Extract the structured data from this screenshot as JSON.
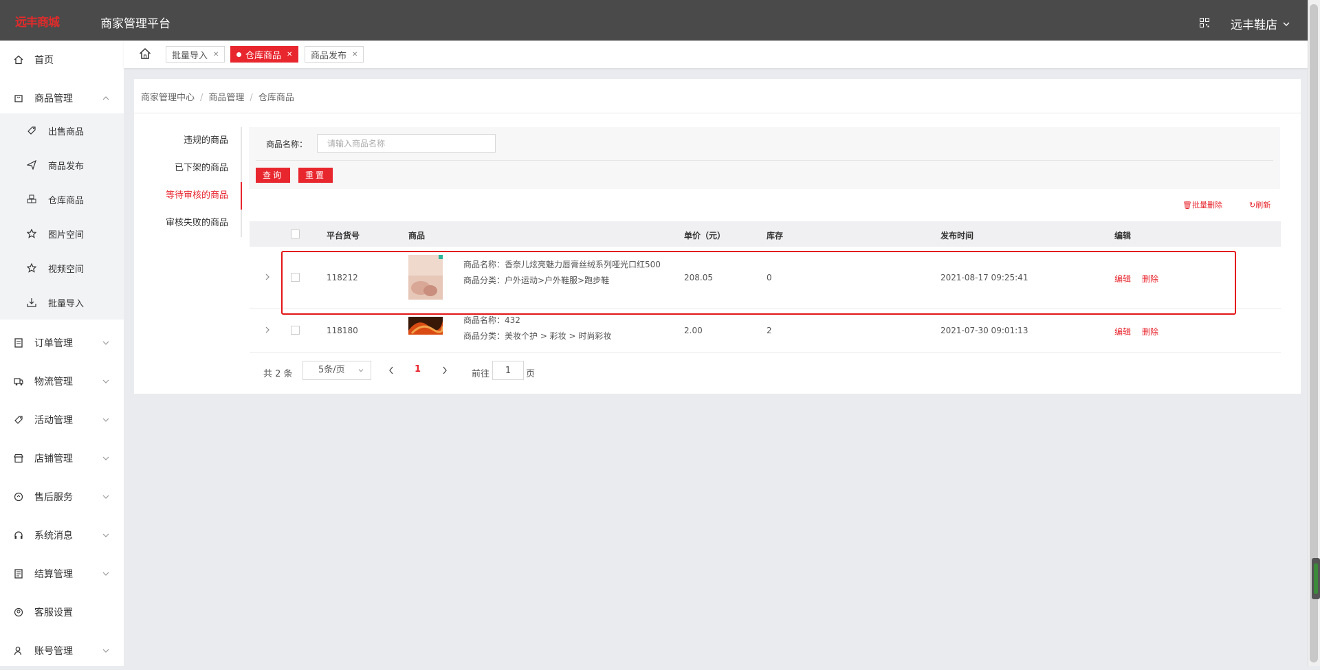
{
  "header": {
    "logo_text": "远丰商城",
    "platform_title": "商家管理平台",
    "shop_name": "远丰鞋店"
  },
  "sidebar": {
    "home": "首页",
    "product_mgmt": "商品管理",
    "sub": [
      "出售商品",
      "商品发布",
      "仓库商品",
      "图片空间",
      "视频空间",
      "批量导入"
    ],
    "order_mgmt": "订单管理",
    "logistics_mgmt": "物流管理",
    "activity_mgmt": "活动管理",
    "store_mgmt": "店铺管理",
    "after_sales": "售后服务",
    "sys_msg": "系统消息",
    "settlement_mgmt": "结算管理",
    "cs_settings": "客服设置",
    "account_mgmt": "账号管理"
  },
  "tabs": [
    {
      "label": "批量导入",
      "active": false
    },
    {
      "label": "仓库商品",
      "active": true
    },
    {
      "label": "商品发布",
      "active": false
    }
  ],
  "breadcrumb": [
    "商家管理中心",
    "商品管理",
    "仓库商品"
  ],
  "status_nav": [
    "违规的商品",
    "已下架的商品",
    "等待审核的商品",
    "审核失败的商品"
  ],
  "filter": {
    "label": "商品名称：",
    "placeholder": "请输入商品名称",
    "query": "查询",
    "reset": "重置"
  },
  "tools": {
    "batch_delete": "批量删除",
    "refresh": "刷新"
  },
  "table": {
    "headers": [
      "平台货号",
      "商品",
      "单价（元）",
      "库存",
      "发布时间",
      "编辑"
    ],
    "rows": [
      {
        "sku": "118212",
        "name": "商品名称：香奈儿炫亮魅力唇膏丝绒系列哑光口红500",
        "category": "商品分类：户外运动>户外鞋服>跑步鞋",
        "price": "208.05",
        "stock": "0",
        "time": "2021-08-17 09:25:41",
        "edit": "编辑",
        "delete": "删除"
      },
      {
        "sku": "118180",
        "name": "商品名称：432",
        "category": "商品分类：美妆个护 > 彩妆 > 时尚彩妆",
        "price": "2.00",
        "stock": "2",
        "time": "2021-07-30 09:01:13",
        "edit": "编辑",
        "delete": "删除"
      }
    ]
  },
  "pagination": {
    "total": "共 2 条",
    "page_size": "5条/页",
    "current": "1",
    "goto": "前往",
    "goto_value": "1",
    "unit": "页"
  },
  "colors": {
    "accent": "#e8262e",
    "header_bg": "#4a4a4a"
  }
}
